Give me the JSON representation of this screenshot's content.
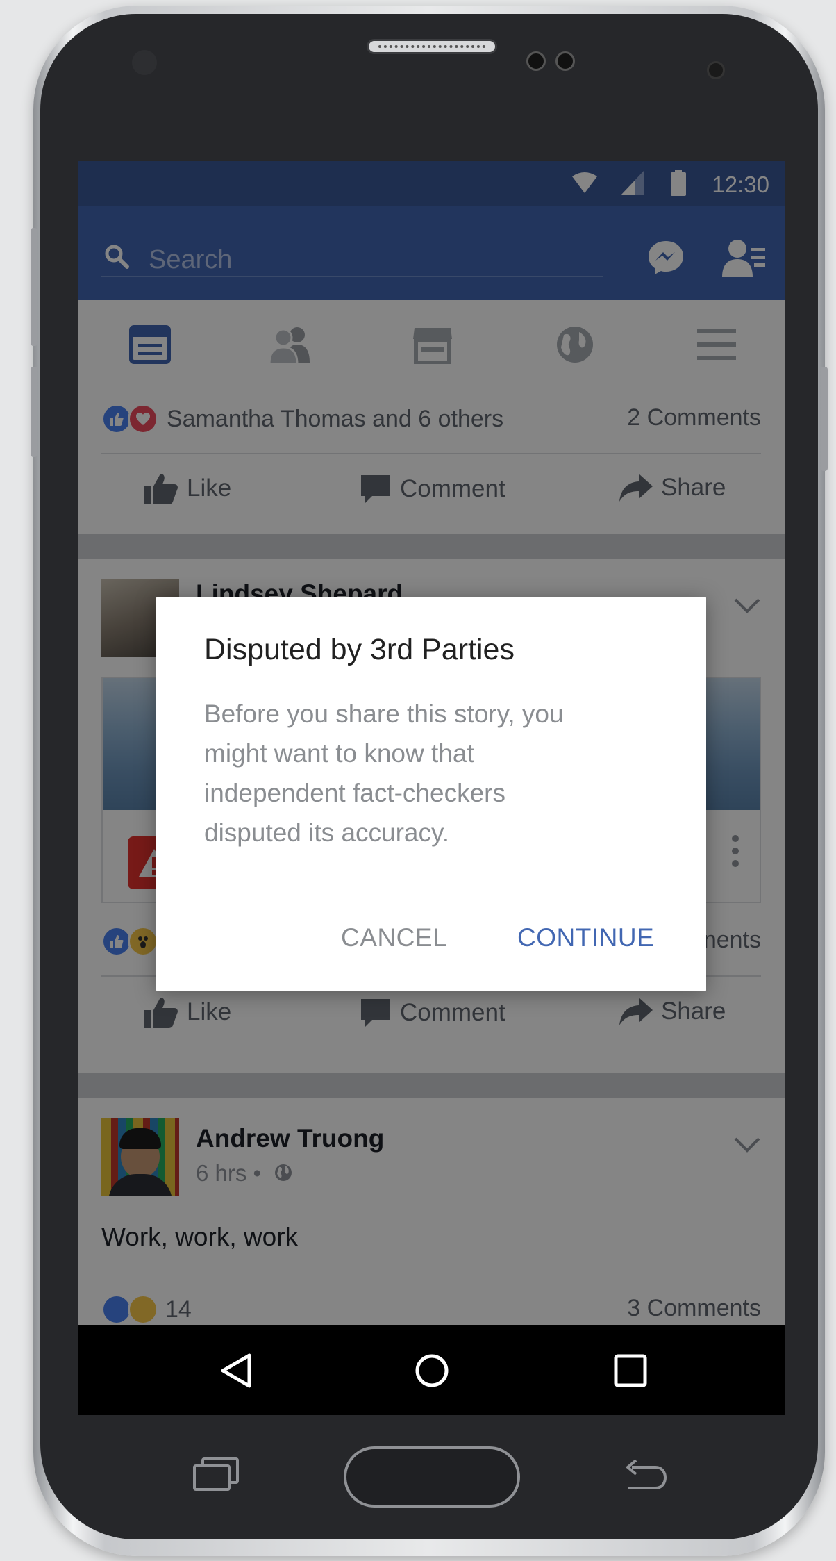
{
  "status_bar": {
    "time": "12:30"
  },
  "app_bar": {
    "search_placeholder": "Search"
  },
  "post1": {
    "reactions_text": "Samantha Thomas and 6 others",
    "comments_text": "2 Comments",
    "actions": {
      "like": "Like",
      "comment": "Comment",
      "share": "Share"
    }
  },
  "post2": {
    "author_partial": "Lindsey Shepard",
    "comments_partial": "nents",
    "actions": {
      "like": "Like",
      "comment": "Comment",
      "share": "Share"
    }
  },
  "post3": {
    "author": "Andrew Truong",
    "time": "6 hrs •",
    "text": "Work, work, work",
    "reaction_count": "14",
    "comments_text": "3 Comments"
  },
  "dialog": {
    "title": "Disputed by 3rd Parties",
    "body": "Before you share this story, you might want to know that independent fact-checkers disputed its accuracy.",
    "cancel_label": "CANCEL",
    "continue_label": "CONTINUE"
  },
  "colors": {
    "facebook_blue": "#4267b2",
    "status_blue": "#3b5998",
    "dialog_continue": "#4267b2",
    "dialog_cancel": "#8a8d91",
    "warning_red": "#e4332f"
  },
  "icons": [
    "search-icon",
    "messenger-icon",
    "friend-requests-icon",
    "news-feed-tab-icon",
    "friends-tab-icon",
    "marketplace-tab-icon",
    "globe-tab-icon",
    "menu-tab-icon",
    "like-reaction-icon",
    "love-reaction-icon",
    "wow-reaction-icon",
    "like-action-icon",
    "comment-action-icon",
    "share-action-icon",
    "chevron-down-icon",
    "warning-icon",
    "more-vertical-icon",
    "back-nav-icon",
    "home-nav-icon",
    "recents-nav-icon"
  ]
}
